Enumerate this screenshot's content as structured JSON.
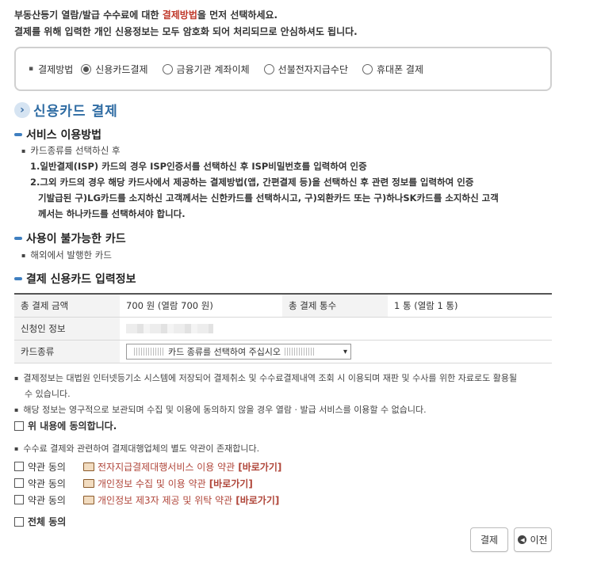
{
  "intro": {
    "line1_pre": "부동산등기 열람/발급 수수료에 대한 ",
    "line1_hl": "결제방법",
    "line1_post": "을 먼저 선택하세요.",
    "line2": "결제를 위해 입력한 개인 신용정보는 모두 암호화 되어 처리되므로 안심하셔도 됩니다."
  },
  "payment_method": {
    "label": "결제방법",
    "options": [
      {
        "label": "신용카드결제",
        "selected": true
      },
      {
        "label": "금융기관 계좌이체",
        "selected": false
      },
      {
        "label": "선불전자지급수단",
        "selected": false
      },
      {
        "label": "휴대폰 결제",
        "selected": false
      }
    ]
  },
  "section_title": "신용카드 결제",
  "usage": {
    "title": "서비스 이용방법",
    "bullet": "카드종류를 선택하신 후",
    "step1": "1.일반결제(ISP) 카드의 경우 ISP인증서를 선택하신 후 ISP비밀번호를 입력하여 인증",
    "step2_line1": "2.그외 카드의 경우 해당 카드사에서 제공하는 결제방법(앱, 간편결제 등)을 선택하신 후 관련 정보를 입력하여 인증",
    "step2_line2": "기발급된 구)LG카드를 소지하신 고객께서는 신한카드를 선택하시고, 구)외환카드 또는 구)하나SK카드를 소지하신 고객",
    "step2_line3": "께서는 하나카드를 선택하셔야 합니다."
  },
  "unavailable": {
    "title": "사용이 불가능한 카드",
    "bullet": "해외에서 발행한 카드"
  },
  "input_info": {
    "title": "결제 신용카드 입력정보",
    "total_amount_label": "총 결제 금액",
    "total_amount_value": "700 원 (열람 700 원)",
    "total_count_label": "총 결제 통수",
    "total_count_value": "1 통 (열람 1 통)",
    "applicant_label": "신청인 정보",
    "card_type_label": "카드종류",
    "card_select_value": "카드 종류를 선택하여 주십시오"
  },
  "notes": {
    "note1_line1": "결제정보는 대법원 인터넷등기소 시스템에 저장되어 결제취소 및 수수료결제내역 조회 시 이용되며 재판 및 수사를 위한 자료로도 활용될",
    "note1_line2": "수 있습니다.",
    "note2": "해당 정보는 영구적으로 보관되며 수집 및 이용에 동의하지 않을 경우 열람 · 발급 서비스를 이용할 수 없습니다.",
    "agree_above": "위 내용에 동의합니다.",
    "note3": "수수료 결제와 관련하여 결제대행업체의 별도 약관이 존재합니다."
  },
  "terms": [
    {
      "agree_label": "약관 동의",
      "name": "전자지급결제대행서비스 이용 약관",
      "link": "[바로가기]"
    },
    {
      "agree_label": "약관 동의",
      "name": "개인정보 수집 및 이용 약관",
      "link": "[바로가기]"
    },
    {
      "agree_label": "약관 동의",
      "name": "개인정보 제3자 제공 및 위탁 약관",
      "link": "[바로가기]"
    }
  ],
  "agree_all": "전체 동의",
  "buttons": {
    "pay": "결제",
    "prev": "이전"
  },
  "colors": {
    "accent_blue": "#2f6ca3",
    "highlight_red": "#c0392b",
    "link_red": "#b0463a"
  }
}
